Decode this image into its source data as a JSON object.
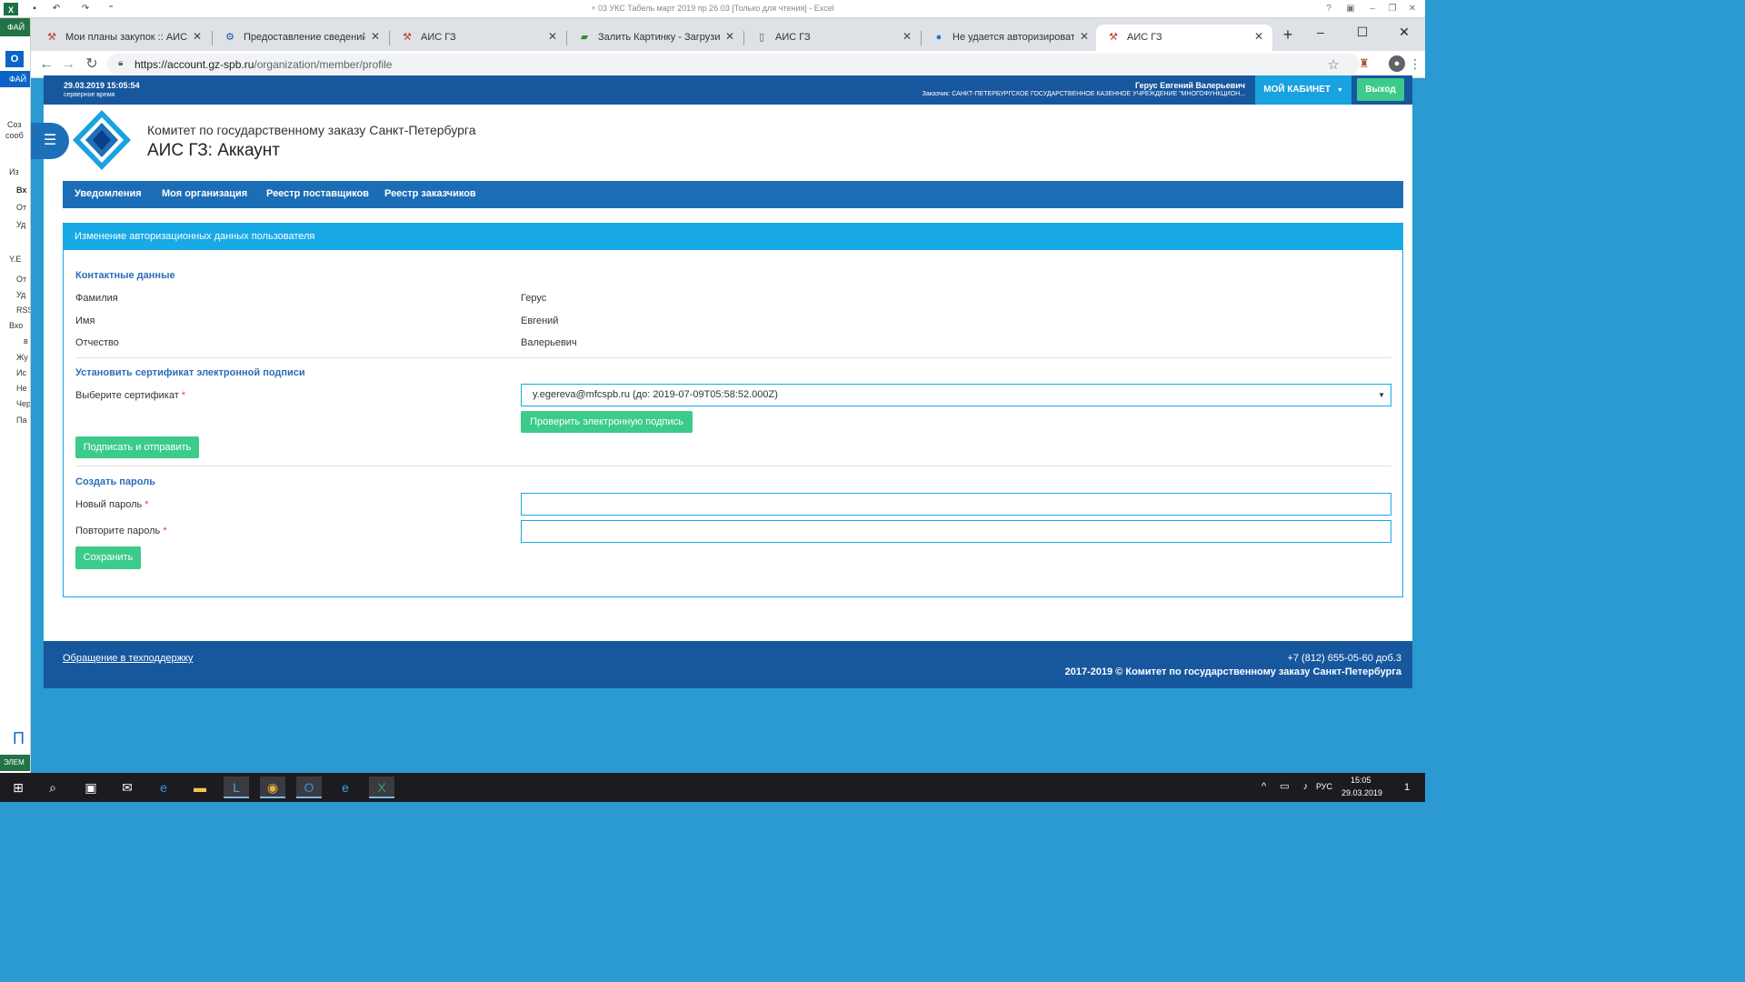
{
  "excel": {
    "title": "+ 03 УКС Табель март 2019 пр 26 03  [Только для чтения] - Excel",
    "file_tab": "ФАЙ",
    "help": "?",
    "left_items": [
      "Соз",
      "сооб",
      "Из",
      "Вх",
      "От",
      "Уд",
      "Y.E",
      "От",
      "Уд",
      "RSS",
      "Вхо",
      "в",
      "Жу",
      "Ис",
      "Не",
      "Чер",
      "Па"
    ],
    "outlook_file": "ФАЙ",
    "bottom_char": "П",
    "bottom_label": "ЭЛЕМ"
  },
  "browser": {
    "tabs": [
      {
        "title": "Мои планы закупок :: АИС ГЗ"
      },
      {
        "title": "Предоставление сведений из Е"
      },
      {
        "title": "АИС ГЗ"
      },
      {
        "title": "Залить Картинку - Загрузить фо"
      },
      {
        "title": "АИС ГЗ"
      },
      {
        "title": "Не удается авторизировать ЭЦ"
      },
      {
        "title": "АИС ГЗ"
      }
    ],
    "url_host": "https://account.gz-spb.ru",
    "url_path": "/organization/member/profile"
  },
  "topbar": {
    "server_time": "29.03.2019 15:05:54",
    "server_time_label": "серверное время",
    "user_name": "Герус Евгений Валерьевич",
    "user_org": "Заказчик: САНКТ-ПЕТЕРБУРГСКОЕ ГОСУДАРСТВЕННОЕ КАЗЕННОЕ УЧРЕЖДЕНИЕ \"МНОГОФУНКЦИОН...",
    "cabinet_label": "МОЙ КАБИНЕТ",
    "exit_label": "Выход"
  },
  "header": {
    "org_title": "Комитет по государственному заказу Санкт-Петербурга",
    "app_title": "АИС ГЗ: Аккаунт"
  },
  "nav": {
    "items": [
      "Уведомления",
      "Моя организация",
      "Реестр поставщиков",
      "Реестр заказчиков"
    ]
  },
  "panel": {
    "title": "Изменение авторизационных данных пользователя",
    "contacts": {
      "title": "Контактные данные",
      "fields": [
        {
          "label": "Фамилия",
          "value": "Герус"
        },
        {
          "label": "Имя",
          "value": "Евгений"
        },
        {
          "label": "Отчество",
          "value": "Валерьевич"
        }
      ]
    },
    "certificate": {
      "title": "Установить сертификат электронной подписи",
      "label": "Выберите сертификат",
      "required_mark": "*",
      "selected": "y.egereva@mfcspb.ru (до: 2019-07-09T05:58:52.000Z)",
      "check_button": "Проверить электронную подпись",
      "sign_button": "Подписать и отправить"
    },
    "password": {
      "title": "Создать пароль",
      "new_label": "Новый пароль",
      "repeat_label": "Повторите пароль",
      "required_mark": "*",
      "new_value": "",
      "repeat_value": "",
      "save_button": "Сохранить"
    }
  },
  "footer": {
    "support_link": "Обращение в техподдержку",
    "phone": "+7 (812) 655-05-60 доб.3",
    "copyright": "2017-2019 © Комитет по государственному заказу Санкт-Петербурга"
  },
  "taskbar": {
    "language": "РУС",
    "time": "15:05",
    "date": "29.03.2019",
    "notification_count": "1"
  },
  "colors": {
    "topbar": "#17579e",
    "nav": "#1b6db6",
    "panel_accent": "#18a9e6",
    "button_green": "#3ccb8b",
    "section_title": "#2a6db8"
  }
}
